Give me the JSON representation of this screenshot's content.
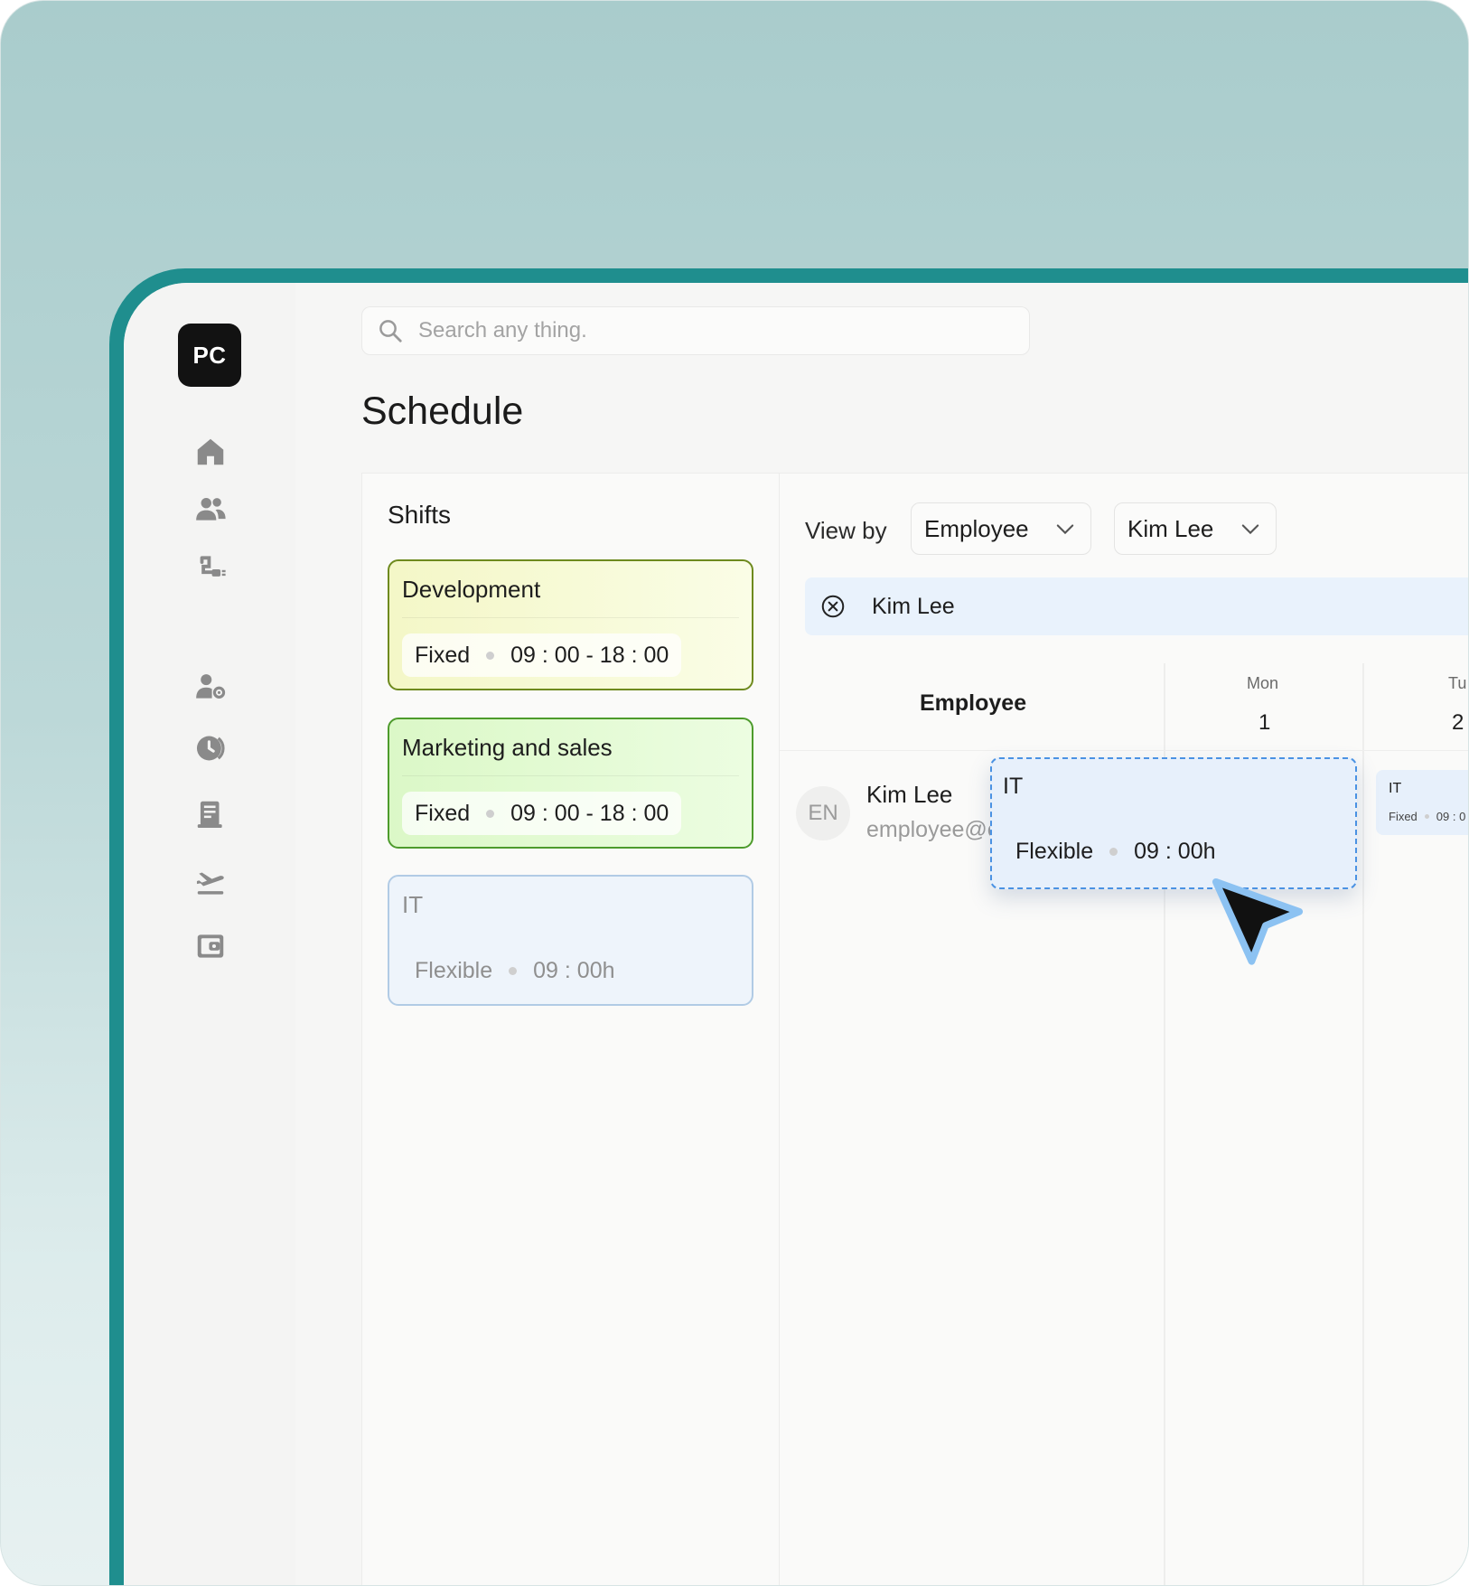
{
  "logo": {
    "text": "PC"
  },
  "search": {
    "placeholder": "Search any thing."
  },
  "page": {
    "title": "Schedule"
  },
  "sidebar": {
    "icons": [
      "home-icon",
      "users-icon",
      "org-chart-icon",
      "user-settings-icon",
      "clock-icon",
      "document-icon",
      "plane-departure-icon",
      "wallet-icon",
      "gear-icon"
    ]
  },
  "shifts": {
    "heading": "Shifts",
    "items": [
      {
        "name": "Development",
        "type": "Fixed",
        "time": "09 : 00 - 18 : 00"
      },
      {
        "name": "Marketing and sales",
        "type": "Fixed",
        "time": "09 : 00 - 18 : 00"
      },
      {
        "name": "IT",
        "type": "Flexible",
        "time": "09 : 00h"
      }
    ]
  },
  "schedule": {
    "view_by_label": "View by",
    "view_by_value": "Employee",
    "employee_filter_value": "Kim Lee",
    "selected_chip": "Kim Lee",
    "columns": {
      "employee_title": "Employee",
      "days": [
        {
          "name": "Mon",
          "num": "1"
        },
        {
          "name": "Tu",
          "num": "2"
        }
      ]
    },
    "row": {
      "avatar_initials": "EN",
      "name": "Kim Lee",
      "email": "employee@e"
    },
    "dragged_shift": {
      "name": "IT",
      "type": "Flexible",
      "time": "09 : 00h"
    },
    "next_day_shift": {
      "name": "IT",
      "type": "Fixed",
      "time": "09 : 0"
    }
  },
  "colors": {
    "accent": "#1f8e8e",
    "development_border": "#6e8a1e",
    "marketing_border": "#4d9b2c",
    "it_border": "#b1cbe5",
    "drag_border": "#4a92e3"
  }
}
